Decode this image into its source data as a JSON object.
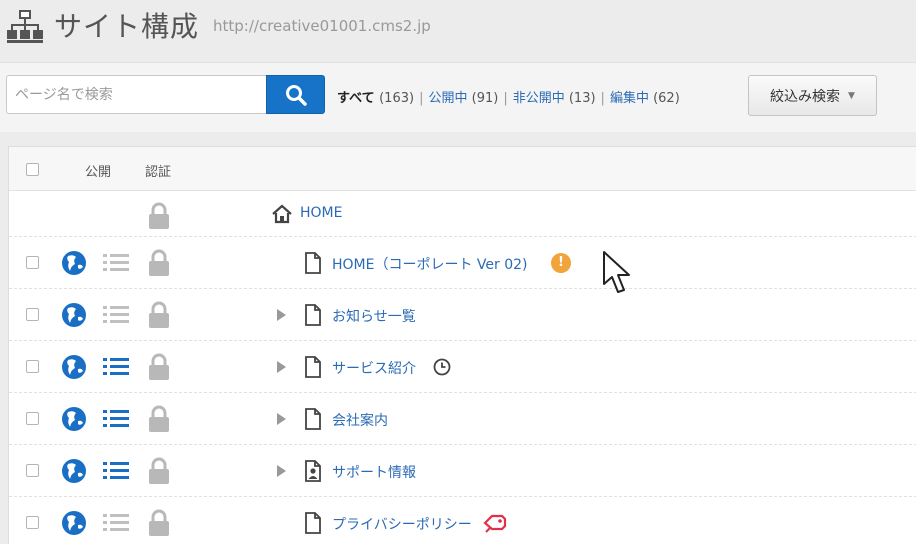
{
  "header": {
    "title": "サイト構成",
    "url": "http://creative01001.cms2.jp"
  },
  "toolbar": {
    "search_placeholder": "ページ名で検索",
    "search_value": "",
    "filters": {
      "all_label": "すべて",
      "all_count": "(163)",
      "public_label": "公開中",
      "public_count": "(91)",
      "private_label": "非公開中",
      "private_count": "(13)",
      "editing_label": "編集中",
      "editing_count": "(62)",
      "separator": "|"
    },
    "narrow_search_label": "絞込み検索"
  },
  "table": {
    "columns": {
      "public": "公開",
      "auth": "認証"
    },
    "rows": [
      {
        "title": "HOME"
      },
      {
        "title": "HOME（コーポレート Ver 02)",
        "badge": "!"
      },
      {
        "title": "お知らせ一覧"
      },
      {
        "title": "サービス紹介"
      },
      {
        "title": "会社案内"
      },
      {
        "title": "サポート情報"
      },
      {
        "title": "プライバシーポリシー"
      }
    ]
  },
  "colors": {
    "accent": "#1673c8",
    "link": "#2b6bb5",
    "warning": "#f0a43a",
    "tag": "#e0304a",
    "globe": "#1a6fc4"
  },
  "icons": [
    "sitemap-icon",
    "search-icon",
    "home-icon",
    "document-icon",
    "globe-icon",
    "list-icon",
    "lock-icon",
    "warning-icon",
    "clock-icon",
    "tag-icon",
    "mouse-cursor-icon"
  ]
}
